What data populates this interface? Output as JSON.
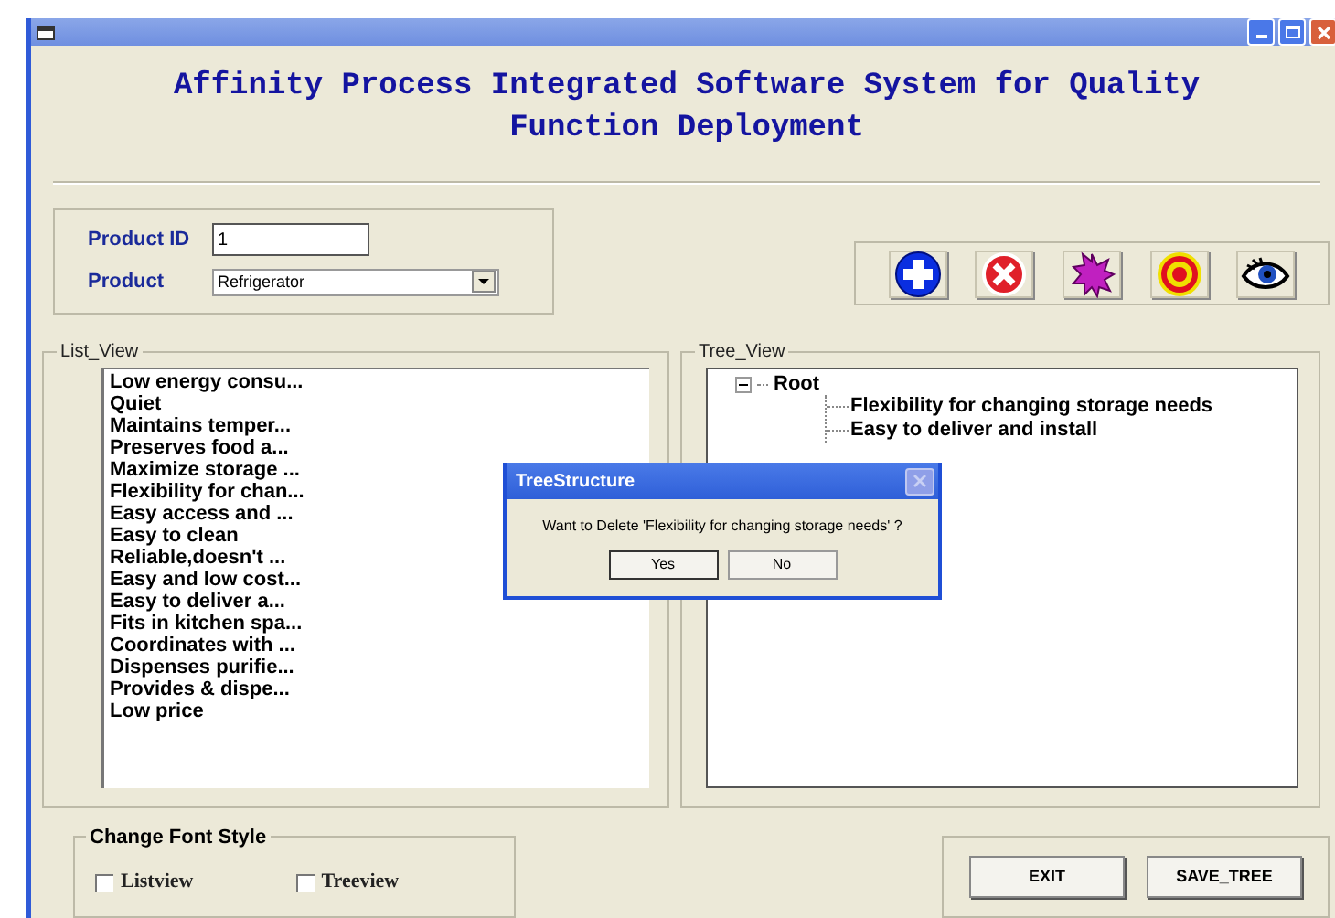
{
  "window": {
    "title": "Affinity Process Integrated Software System for Quality Function Deployment"
  },
  "product_panel": {
    "product_id_label": "Product ID",
    "product_id_value": "1",
    "product_label": "Product",
    "product_value": "Refrigerator"
  },
  "toolbar": [
    {
      "kind": "add"
    },
    {
      "kind": "delete"
    },
    {
      "kind": "star"
    },
    {
      "kind": "target"
    },
    {
      "kind": "view"
    }
  ],
  "list_view": {
    "title": "List_View",
    "items": [
      "Low energy consu...",
      "Quiet",
      "Maintains temper...",
      "Preserves food a...",
      "Maximize storage ...",
      "Flexibility for chan...",
      "Easy access and ...",
      "Easy to clean",
      "Reliable,doesn't ...",
      "Easy and low cost...",
      "Easy to deliver a...",
      "Fits in kitchen spa...",
      "Coordinates with ...",
      "Dispenses purifie...",
      "Provides & dispe...",
      "Low price"
    ]
  },
  "tree_view": {
    "title": "Tree_View",
    "root": {
      "label": "Root",
      "expanded": true,
      "children": [
        {
          "label": "Flexibility for changing storage needs"
        },
        {
          "label": "Easy to deliver and install"
        }
      ]
    }
  },
  "font_style": {
    "title": "Change Font Style",
    "options": [
      {
        "label": "Listview",
        "checked": false
      },
      {
        "label": "Treeview",
        "checked": false
      }
    ]
  },
  "buttons": [
    "EXIT",
    "SAVE_TREE"
  ],
  "dialog": {
    "title": "TreeStructure",
    "message": "Want to Delete 'Flexibility for changing storage needs' ?",
    "buttons": [
      "Yes",
      "No"
    ]
  }
}
